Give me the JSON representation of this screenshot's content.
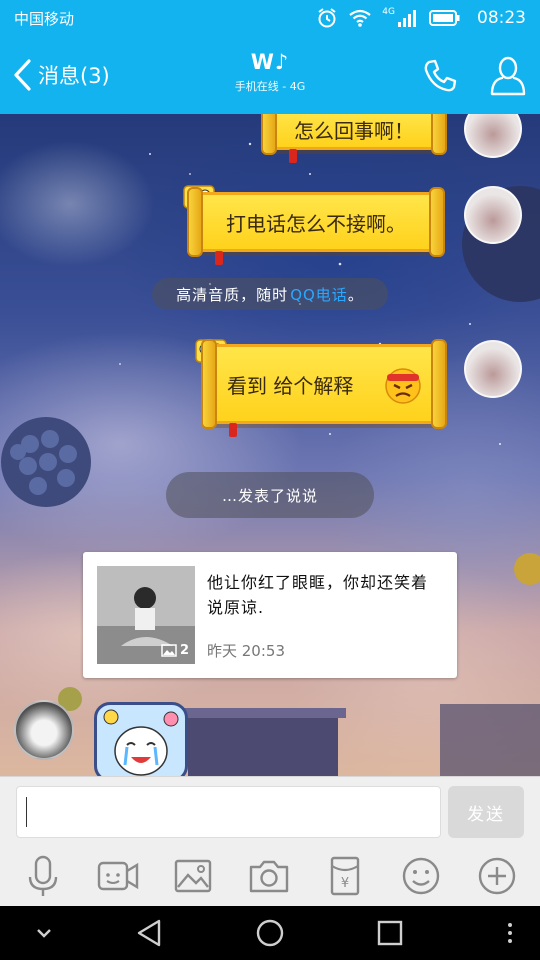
{
  "status_bar": {
    "carrier": "中国移动",
    "network_badge": "4G",
    "time": "08:23"
  },
  "header": {
    "back_label": "消息(3)",
    "contact_name": "W♪",
    "contact_status": "手机在线 - 4G"
  },
  "messages": [
    {
      "type": "sticker-text",
      "side": "right",
      "text": "怎么回事啊！"
    },
    {
      "type": "sticker-text",
      "side": "right",
      "text": "打电话怎么不接啊。"
    },
    {
      "type": "system-notice",
      "text": "高清音质，随时",
      "link": "QQ电话",
      "suffix": "。"
    },
    {
      "type": "sticker-text",
      "side": "right",
      "text": "看到 给个解释"
    },
    {
      "type": "system-notice",
      "text": "…发表了说说"
    },
    {
      "type": "share-card",
      "text": "他让你红了眼眶，你却还笑着说原谅.",
      "image_count": "2",
      "time": "昨天 20:53"
    }
  ],
  "input": {
    "value": "",
    "send_label": "发送"
  },
  "toolbar": [
    "mic-icon",
    "video-icon",
    "image-icon",
    "camera-icon",
    "red-packet-icon",
    "emoji-icon",
    "plus-icon"
  ],
  "nav": [
    "collapse-icon",
    "back-icon",
    "home-icon",
    "recents-icon",
    "more-icon"
  ],
  "colors": {
    "brand_blue": "#12b3ee",
    "scroll_yellow": "#ffd21c",
    "link_blue": "#2aa8ff"
  }
}
